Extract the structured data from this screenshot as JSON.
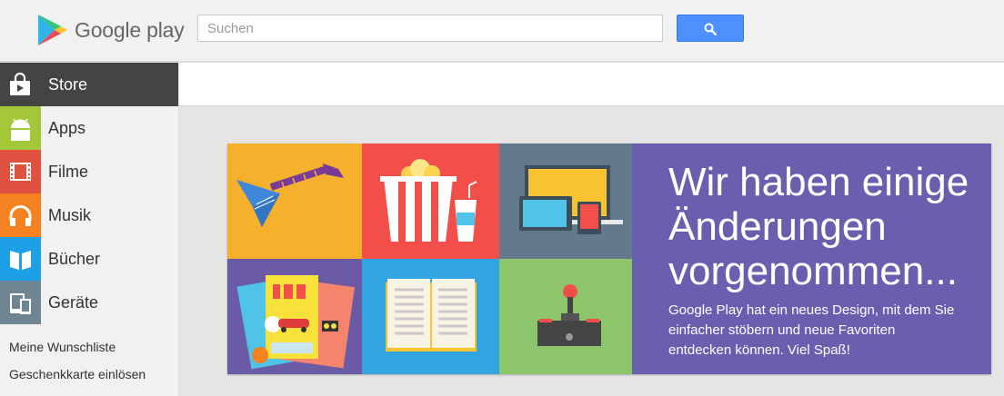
{
  "header": {
    "logo_text": "Google play",
    "search_placeholder": "Suchen"
  },
  "sidebar": {
    "items": [
      {
        "label": "Store",
        "icon": "shopping-bag-icon",
        "color": "#444444",
        "active": true
      },
      {
        "label": "Apps",
        "icon": "android-icon",
        "color": "#a4c639"
      },
      {
        "label": "Filme",
        "icon": "film-icon",
        "color": "#e0523f"
      },
      {
        "label": "Musik",
        "icon": "headphones-icon",
        "color": "#f58220"
      },
      {
        "label": "Bücher",
        "icon": "book-icon",
        "color": "#1ea0e6"
      },
      {
        "label": "Geräte",
        "icon": "device-icon",
        "color": "#708592"
      }
    ],
    "links": [
      "Meine Wunschliste",
      "Geschenkkarte einlösen"
    ]
  },
  "promo": {
    "title": "Wir haben einige Änderungen vorgenommen...",
    "text": "Google Play hat ein neues Design, mit dem Sie einfacher stöbern und neue Favoriten entdecken können. Viel Spaß!",
    "background": "#6a5fae"
  },
  "colors": {
    "accent": "#4d90fe",
    "tile_guitar": "#f6b12c",
    "tile_popcorn": "#f24f4a",
    "tile_devices": "#627a8b",
    "tile_magazines": "#6b5ba6",
    "tile_book": "#32a4df",
    "tile_joystick": "#8cc56b"
  }
}
